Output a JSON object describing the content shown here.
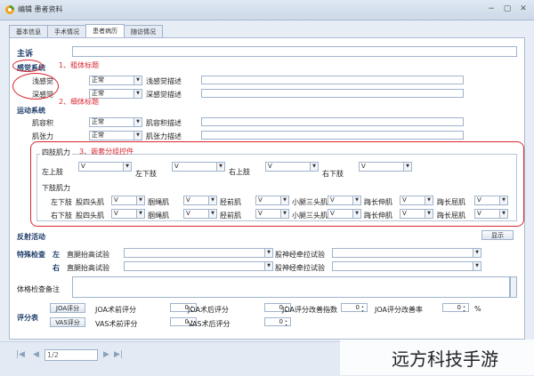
{
  "window": {
    "title": "编辑 患者资料",
    "buttons": [
      "−",
      "▢",
      "✕"
    ]
  },
  "tabs": [
    "基本信息",
    "手术情况",
    "患者病历",
    "随访情况"
  ],
  "active_tab": 2,
  "section_main": "主诉",
  "sensory": {
    "title": "感觉系统",
    "rows": [
      {
        "label": "浅感觉",
        "value": "正常",
        "desc": "浅感觉描述"
      },
      {
        "label": "深感觉",
        "value": "正常",
        "desc": "深感觉描述"
      }
    ]
  },
  "annotations": [
    "1、粗体标题",
    "2、细体标题",
    "3、嵌套分组控件"
  ],
  "motor": {
    "title": "运动系统",
    "rows": [
      {
        "label": "肌容积",
        "value": "正常",
        "desc": "肌容积描述"
      },
      {
        "label": "肌张力",
        "value": "正常",
        "desc": "肌张力描述"
      }
    ]
  },
  "limb": {
    "group_title": "四肢肌力",
    "upper": [
      {
        "label": "左上肢",
        "value": "V"
      },
      {
        "label": "左下肢",
        "value": "V"
      },
      {
        "label": "右上肢",
        "value": "V"
      },
      {
        "label": "右下肢",
        "value": "V"
      }
    ],
    "lower_title": "下肢肌力",
    "lower_rows": [
      {
        "side": "左下肢",
        "cells": [
          {
            "label": "股四头肌",
            "value": "V"
          },
          {
            "label": "腘绳肌",
            "value": "V"
          },
          {
            "label": "胫前肌",
            "value": "V"
          },
          {
            "label": "小腿三头肌",
            "value": "V"
          },
          {
            "label": "踇长伸肌",
            "value": "V"
          },
          {
            "label": "踇长屈肌",
            "value": "V"
          }
        ]
      },
      {
        "side": "右下肢",
        "cells": [
          {
            "label": "股四头肌",
            "value": "V"
          },
          {
            "label": "腘绳肌",
            "value": "V"
          },
          {
            "label": "胫前肌",
            "value": "V"
          },
          {
            "label": "小腿三头肌",
            "value": "V"
          },
          {
            "label": "踇长伸肌",
            "value": "V"
          },
          {
            "label": "踇长屈肌",
            "value": "V"
          }
        ]
      }
    ]
  },
  "reflex": {
    "title": "反射活动",
    "button": "显示"
  },
  "special": {
    "title": "特殊检查",
    "rows": [
      {
        "side": "左",
        "a": "直腿抬高试验",
        "b": "股神经牵拉试验"
      },
      {
        "side": "右",
        "a": "直腿抬高试验",
        "b": "股神经牵拉试验"
      }
    ]
  },
  "physical_note": "体格检查备注",
  "score": {
    "title": "评分表",
    "rows": [
      {
        "button": "JOA评分",
        "items": [
          {
            "label": "JOA术前评分",
            "value": "0"
          },
          {
            "label": "JOA术后评分",
            "value": "0"
          },
          {
            "label": "JOA评分改善指数",
            "value": "0"
          },
          {
            "label": "JOA评分改善率",
            "value": "0"
          }
        ],
        "unit": "%"
      },
      {
        "button": "VAS评分",
        "items": [
          {
            "label": "VAS术前评分",
            "value": "0"
          },
          {
            "label": "VAS术后评分",
            "value": "0"
          }
        ]
      }
    ]
  },
  "pager": {
    "text": "1/2"
  },
  "watermark": "远方科技手游"
}
